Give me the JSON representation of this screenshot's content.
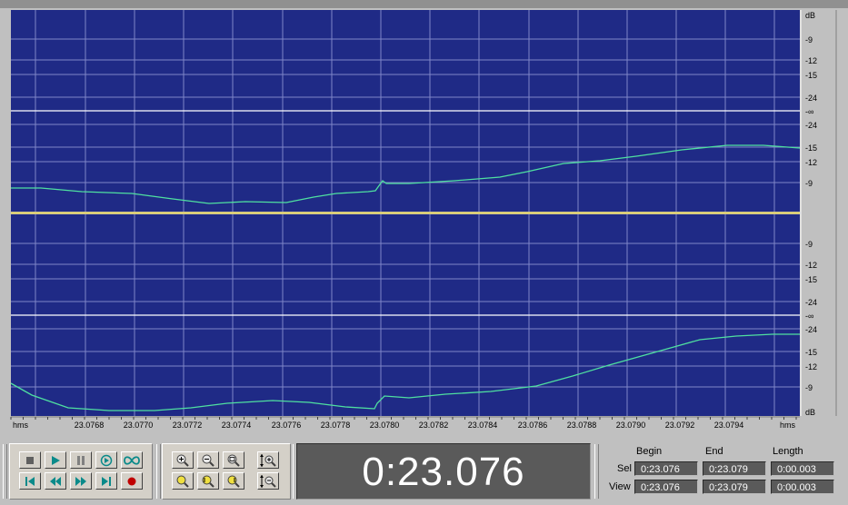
{
  "waveform": {
    "ruler_unit_left": "hms",
    "ruler_unit_right": "hms",
    "time_ticks": [
      "23.0768",
      "23.0770",
      "23.0772",
      "23.0774",
      "23.0776",
      "23.0778",
      "23.0780",
      "23.0782",
      "23.0784",
      "23.0786",
      "23.0788",
      "23.0790",
      "23.0792",
      "23.0794"
    ],
    "db_unit": "dB",
    "db_labels_top": [
      "dB",
      "-9",
      "-12",
      "-15",
      "-24",
      "-∞",
      "-24",
      "-15",
      "-12",
      "-9"
    ],
    "db_labels_bottom": [
      "-9",
      "-12",
      "-15",
      "-24",
      "-∞",
      "-24",
      "-15",
      "-12",
      "-9",
      "dB"
    ],
    "colors": {
      "background": "#1f2a86",
      "grid": "#7f86c8",
      "wave": "#4fe0a0",
      "center": "#ffffff",
      "divider": "#e0d060"
    }
  },
  "transport": {
    "buttons": [
      "stop",
      "play",
      "pause",
      "play-looped",
      "loop",
      "go-to-start",
      "rewind",
      "fast-forward",
      "go-to-end",
      "record"
    ]
  },
  "zoom": {
    "buttons": [
      "zoom-in",
      "zoom-out",
      "zoom-full",
      "zoom-selection",
      "zoom-left",
      "zoom-right",
      "zoom-in-vertical",
      "zoom-out-vertical"
    ]
  },
  "time": {
    "display": "0:23.076"
  },
  "selection": {
    "headers": [
      "Begin",
      "End",
      "Length"
    ],
    "sel_label": "Sel",
    "view_label": "View",
    "sel": [
      "0:23.076",
      "0:23.079",
      "0:00.003"
    ],
    "view": [
      "0:23.076",
      "0:23.079",
      "0:00.003"
    ]
  }
}
